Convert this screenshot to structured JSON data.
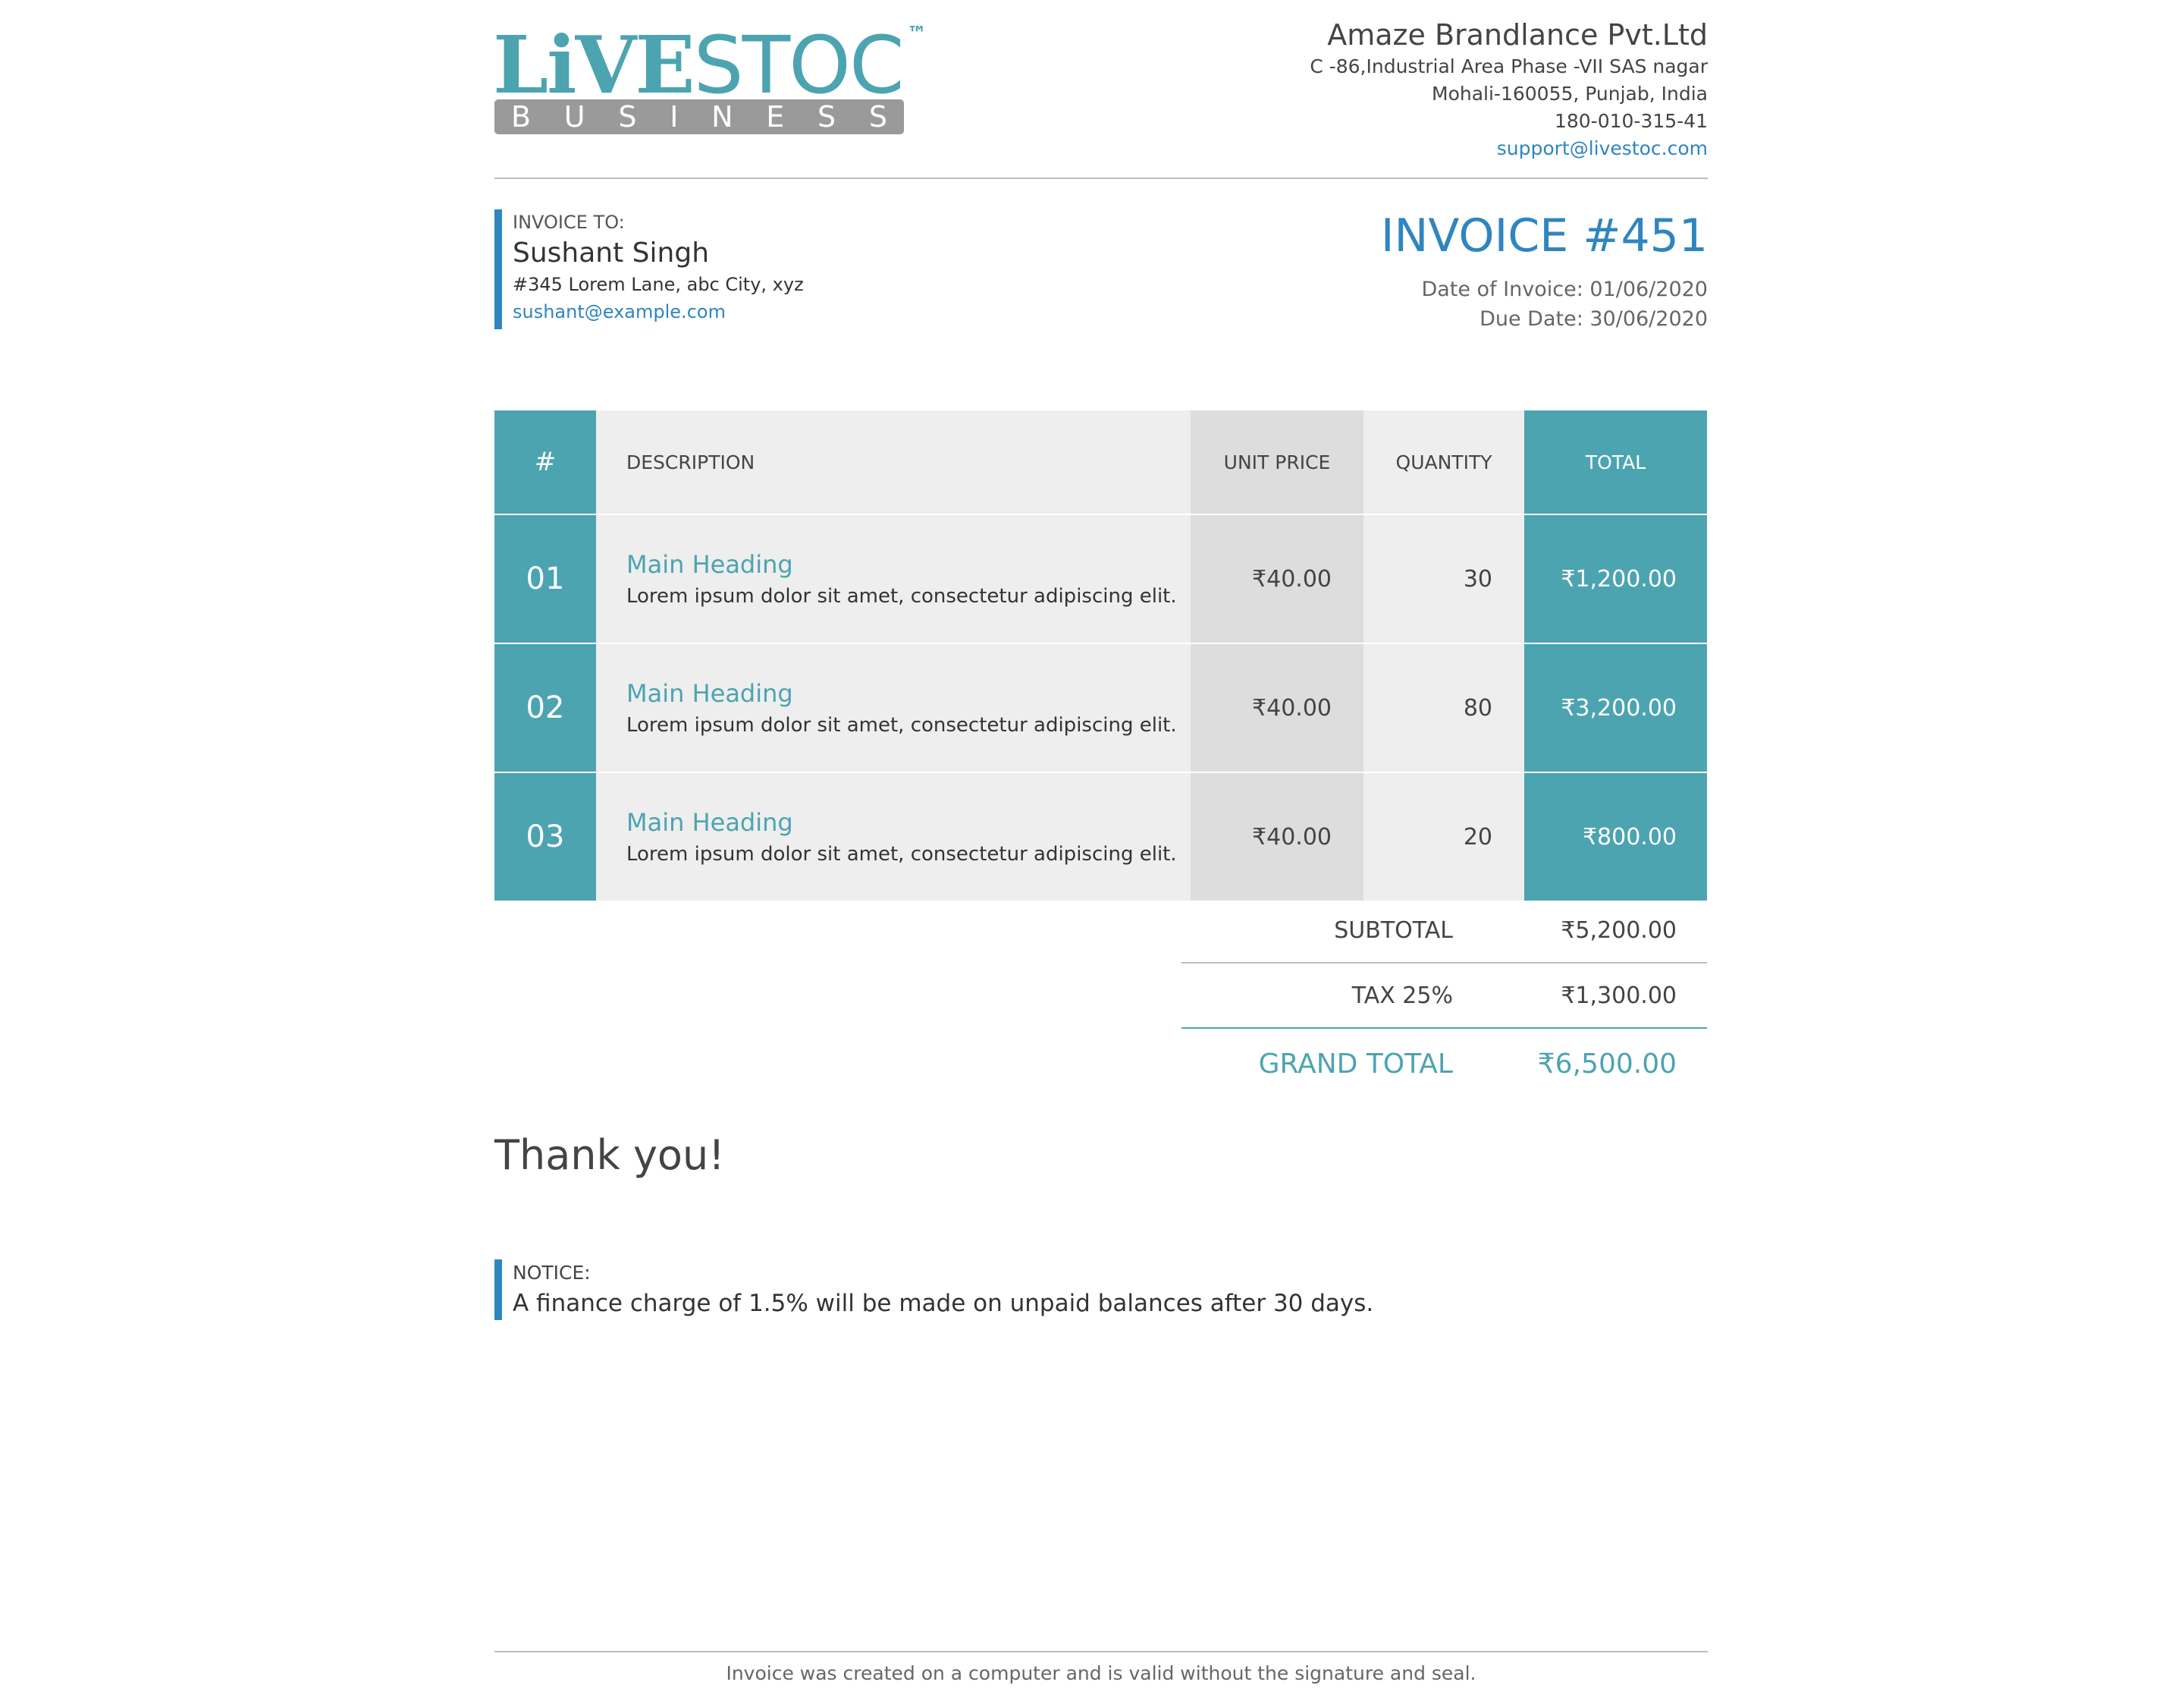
{
  "logo": {
    "word_part1": "LiVE",
    "word_part2": "STOC",
    "trademark": "™",
    "sub_letters": [
      "B",
      "U",
      "S",
      "I",
      "N",
      "E",
      "S",
      "S"
    ]
  },
  "company": {
    "name": "Amaze Brandlance Pvt.Ltd",
    "address_line1": "C -86,Industrial Area Phase -VII SAS nagar",
    "address_line2": "Mohali-160055, Punjab, India",
    "phone": "180-010-315-41",
    "email": "support@livestoc.com"
  },
  "bill_to": {
    "label": "INVOICE TO:",
    "name": "Sushant Singh",
    "address": "#345 Lorem Lane, abc City, xyz",
    "email": "sushant@example.com"
  },
  "invoice": {
    "title": "INVOICE #451",
    "date_line": "Date of Invoice: 01/06/2020",
    "due_line": "Due Date: 30/06/2020"
  },
  "table": {
    "headers": {
      "no": "#",
      "description": "DESCRIPTION",
      "unit_price": "UNIT PRICE",
      "quantity": "QUANTITY",
      "total": "TOTAL"
    },
    "rows": [
      {
        "no": "01",
        "heading": "Main Heading",
        "text": "Lorem ipsum dolor sit amet, consectetur adipiscing elit.",
        "unit_price": "₹40.00",
        "quantity": "30",
        "total": "₹1,200.00"
      },
      {
        "no": "02",
        "heading": "Main Heading",
        "text": "Lorem ipsum dolor sit amet, consectetur adipiscing elit.",
        "unit_price": "₹40.00",
        "quantity": "80",
        "total": "₹3,200.00"
      },
      {
        "no": "03",
        "heading": "Main Heading",
        "text": "Lorem ipsum dolor sit amet, consectetur adipiscing elit.",
        "unit_price": "₹40.00",
        "quantity": "20",
        "total": "₹800.00"
      }
    ]
  },
  "totals": {
    "subtotal_label": "SUBTOTAL",
    "subtotal_value": "₹5,200.00",
    "tax_label": "TAX 25%",
    "tax_value": "₹1,300.00",
    "grand_label": "GRAND TOTAL",
    "grand_value": "₹6,500.00"
  },
  "thanks": "Thank you!",
  "notice": {
    "label": "NOTICE:",
    "text": "A finance charge of 1.5% will be made on unpaid balances after 30 days."
  },
  "footer": "Invoice was created on a computer and is valid without the signature and seal.",
  "colors": {
    "teal": "#4ca4b0",
    "blue": "#2f85c0",
    "gray_cell": "#eeeeee",
    "dark_gray_cell": "#dddddd"
  }
}
